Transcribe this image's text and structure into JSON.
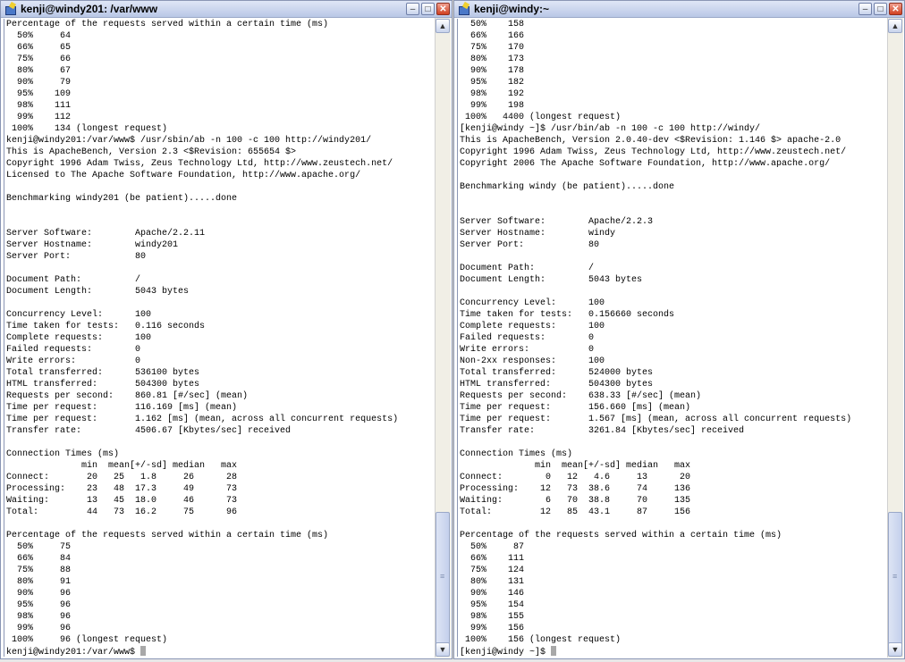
{
  "windows": {
    "left": {
      "title": "kenji@windy201: /var/www",
      "lines": [
        "Percentage of the requests served within a certain time (ms)",
        "  50%     64",
        "  66%     65",
        "  75%     66",
        "  80%     67",
        "  90%     79",
        "  95%    109",
        "  98%    111",
        "  99%    112",
        " 100%    134 (longest request)",
        "kenji@windy201:/var/www$ /usr/sbin/ab -n 100 -c 100 http://windy201/",
        "This is ApacheBench, Version 2.3 <$Revision: 655654 $>",
        "Copyright 1996 Adam Twiss, Zeus Technology Ltd, http://www.zeustech.net/",
        "Licensed to The Apache Software Foundation, http://www.apache.org/",
        "",
        "Benchmarking windy201 (be patient).....done",
        "",
        "",
        "Server Software:        Apache/2.2.11",
        "Server Hostname:        windy201",
        "Server Port:            80",
        "",
        "Document Path:          /",
        "Document Length:        5043 bytes",
        "",
        "Concurrency Level:      100",
        "Time taken for tests:   0.116 seconds",
        "Complete requests:      100",
        "Failed requests:        0",
        "Write errors:           0",
        "Total transferred:      536100 bytes",
        "HTML transferred:       504300 bytes",
        "Requests per second:    860.81 [#/sec] (mean)",
        "Time per request:       116.169 [ms] (mean)",
        "Time per request:       1.162 [ms] (mean, across all concurrent requests)",
        "Transfer rate:          4506.67 [Kbytes/sec] received",
        "",
        "Connection Times (ms)",
        "              min  mean[+/-sd] median   max",
        "Connect:       20   25   1.8     26      28",
        "Processing:    23   48  17.3     49      73",
        "Waiting:       13   45  18.0     46      73",
        "Total:         44   73  16.2     75      96",
        "",
        "Percentage of the requests served within a certain time (ms)",
        "  50%     75",
        "  66%     84",
        "  75%     88",
        "  80%     91",
        "  90%     96",
        "  95%     96",
        "  98%     96",
        "  99%     96",
        " 100%     96 (longest request)"
      ],
      "prompt": "kenji@windy201:/var/www$ "
    },
    "right": {
      "title": "kenji@windy:~",
      "lines": [
        "  50%    158",
        "  66%    166",
        "  75%    170",
        "  80%    173",
        "  90%    178",
        "  95%    182",
        "  98%    192",
        "  99%    198",
        " 100%   4400 (longest request)",
        "[kenji@windy ~]$ /usr/bin/ab -n 100 -c 100 http://windy/",
        "This is ApacheBench, Version 2.0.40-dev <$Revision: 1.146 $> apache-2.0",
        "Copyright 1996 Adam Twiss, Zeus Technology Ltd, http://www.zeustech.net/",
        "Copyright 2006 The Apache Software Foundation, http://www.apache.org/",
        "",
        "Benchmarking windy (be patient).....done",
        "",
        "",
        "Server Software:        Apache/2.2.3",
        "Server Hostname:        windy",
        "Server Port:            80",
        "",
        "Document Path:          /",
        "Document Length:        5043 bytes",
        "",
        "Concurrency Level:      100",
        "Time taken for tests:   0.156660 seconds",
        "Complete requests:      100",
        "Failed requests:        0",
        "Write errors:           0",
        "Non-2xx responses:      100",
        "Total transferred:      524000 bytes",
        "HTML transferred:       504300 bytes",
        "Requests per second:    638.33 [#/sec] (mean)",
        "Time per request:       156.660 [ms] (mean)",
        "Time per request:       1.567 [ms] (mean, across all concurrent requests)",
        "Transfer rate:          3261.84 [Kbytes/sec] received",
        "",
        "Connection Times (ms)",
        "              min  mean[+/-sd] median   max",
        "Connect:        0   12   4.6     13      20",
        "Processing:    12   73  38.6     74     136",
        "Waiting:        6   70  38.8     70     135",
        "Total:         12   85  43.1     87     156",
        "",
        "Percentage of the requests served within a certain time (ms)",
        "  50%     87",
        "  66%    111",
        "  75%    124",
        "  80%    131",
        "  90%    146",
        "  95%    154",
        "  98%    155",
        "  99%    156",
        " 100%    156 (longest request)"
      ],
      "prompt": "[kenji@windy ~]$ "
    }
  },
  "buttons": {
    "minimize": "–",
    "maximize": "□",
    "close": "✕",
    "scroll_up": "▲",
    "scroll_down": "▼"
  }
}
